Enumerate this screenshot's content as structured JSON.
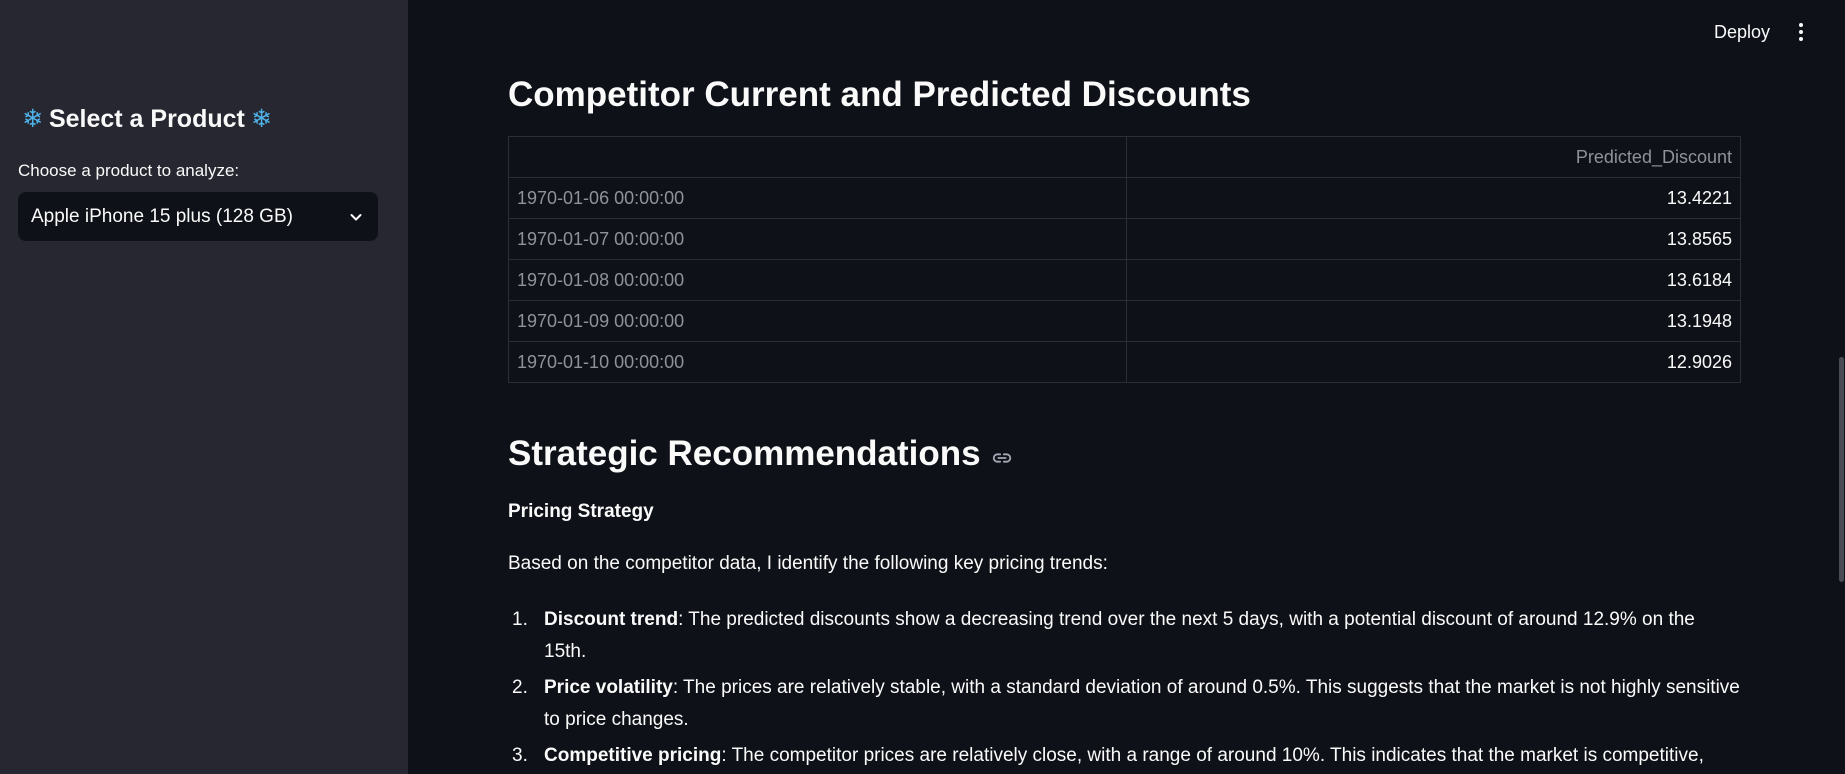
{
  "header": {
    "deploy_label": "Deploy"
  },
  "sidebar": {
    "title": "Select a Product",
    "choose_label": "Choose a product to analyze:",
    "selected_product": "Apple iPhone 15 plus (128 GB)"
  },
  "main": {
    "discounts_heading": "Competitor Current and Predicted Discounts",
    "table": {
      "columns": [
        "",
        "Predicted_Discount"
      ],
      "rows": [
        {
          "index": "1970-01-06 00:00:00",
          "value": "13.4221"
        },
        {
          "index": "1970-01-07 00:00:00",
          "value": "13.8565"
        },
        {
          "index": "1970-01-08 00:00:00",
          "value": "13.6184"
        },
        {
          "index": "1970-01-09 00:00:00",
          "value": "13.1948"
        },
        {
          "index": "1970-01-10 00:00:00",
          "value": "12.9026"
        }
      ]
    },
    "recs_heading": "Strategic Recommendations",
    "pricing_strategy": "Pricing Strategy",
    "intro": "Based on the competitor data, I identify the following key pricing trends:",
    "items": [
      {
        "num": "1.",
        "term": "Discount trend",
        "text": ": The predicted discounts show a decreasing trend over the next 5 days, with a potential discount of around 12.9% on the 15th."
      },
      {
        "num": "2.",
        "term": "Price volatility",
        "text": ": The prices are relatively stable, with a standard deviation of around 0.5%. This suggests that the market is not highly sensitive to price changes."
      },
      {
        "num": "3.",
        "term": "Competitive pricing",
        "text": ": The competitor prices are relatively close, with a range of around 10%. This indicates that the market is competitive, and prices need to be competitive to attract customers."
      }
    ]
  },
  "colors": {
    "bg": "#0e1117",
    "sidebar": "#262730",
    "accent_snow": "#4fb3ea"
  },
  "icons": {
    "snowflake": "snowflake-icon",
    "link": "link-icon",
    "chevron": "chevron-down-icon",
    "menu": "more-vertical-icon"
  }
}
